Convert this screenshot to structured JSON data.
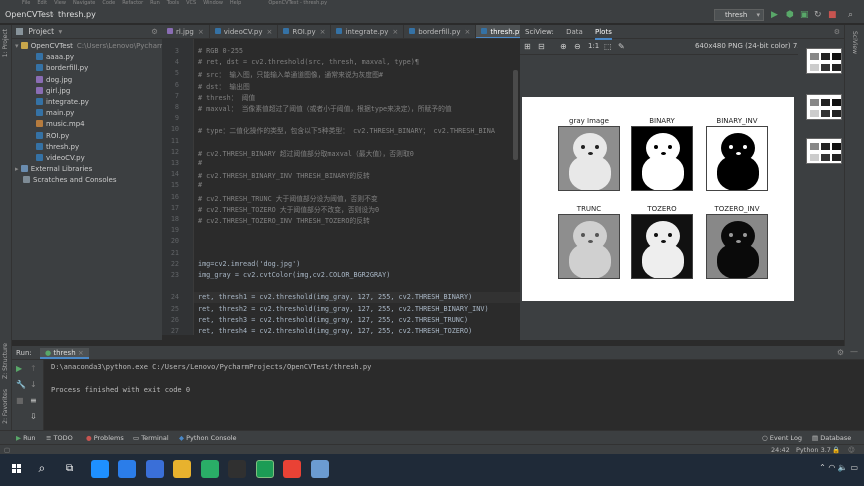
{
  "menu": [
    "File",
    "Edit",
    "View",
    "Navigate",
    "Code",
    "Refactor",
    "Run",
    "Tools",
    "VCS",
    "Window",
    "Help"
  ],
  "window_title": "OpenCVTest - thresh.py",
  "navbar": {
    "project": "OpenCVTest",
    "file": "thresh.py",
    "run_config": "thresh"
  },
  "project_panel": {
    "title": "Project",
    "root": {
      "name": "OpenCVTest",
      "path": "C:\\Users\\Lenovo\\PycharmProjects\\OpenCVTest"
    },
    "files": [
      "aaaa.py",
      "borderfill.py",
      "dog.jpg",
      "girl.jpg",
      "integrate.py",
      "main.py",
      "music.mp4",
      "ROI.py",
      "thresh.py",
      "videoCV.py"
    ],
    "external_libraries": "External Libraries",
    "scratches": "Scratches and Consoles"
  },
  "editor_tabs": [
    "rl.jpg",
    "videoCV.py",
    "ROI.py",
    "integrate.py",
    "borderfill.py",
    "thresh.py"
  ],
  "inspection": {
    "warnings": "4",
    "weak_warnings": "4"
  },
  "code_lines": [
    {
      "n": "3",
      "t": "# RGB 0-255"
    },
    {
      "n": "4",
      "t": "# ret, dst = cv2.threshold(src, thresh, maxval, type)¶"
    },
    {
      "n": "5",
      "t": "# src： 输入图，只能输入单通道图像，通常来说为灰度图#"
    },
    {
      "n": "6",
      "t": "# dst： 输出图"
    },
    {
      "n": "7",
      "t": "# thresh： 阈值"
    },
    {
      "n": "8",
      "t": "# maxval： 当像素值超过了阈值（或者小于阈值，根据type来决定），所赋予的值"
    },
    {
      "n": "9",
      "t": ""
    },
    {
      "n": "10",
      "t": "# type：二值化操作的类型，包含以下5种类型： cv2.THRESH_BINARY； cv2.THRESH_BINA"
    },
    {
      "n": "11",
      "t": ""
    },
    {
      "n": "12",
      "t": "# cv2.THRESH_BINARY 超过阈值部分取maxval（最大值），否则取0"
    },
    {
      "n": "13",
      "t": "#"
    },
    {
      "n": "14",
      "t": "# cv2.THRESH_BINARY_INV THRESH_BINARY的反转"
    },
    {
      "n": "15",
      "t": "#"
    },
    {
      "n": "16",
      "t": "# cv2.THRESH_TRUNC 大于阈值部分设为阈值，否则不变"
    },
    {
      "n": "17",
      "t": "# cv2.THRESH_TOZERO 大于阈值部分不改变，否则设为0"
    },
    {
      "n": "18",
      "t": "# cv2.THRESH_TOZERO_INV THRESH_TOZERO的反转"
    },
    {
      "n": "19",
      "t": ""
    },
    {
      "n": "20",
      "t": ""
    },
    {
      "n": "21",
      "t": ""
    },
    {
      "n": "22",
      "t": "img=cv2.imread('dog.jpg')"
    },
    {
      "n": "23",
      "t": "img_gray = cv2.cvtColor(img,cv2.COLOR_BGR2GRAY)"
    },
    {
      "n": "",
      "t": ""
    },
    {
      "n": "24",
      "t": "ret, thresh1 = cv2.threshold(img_gray, 127, 255, cv2.THRESH_BINARY)"
    },
    {
      "n": "25",
      "t": "ret, thresh2 = cv2.threshold(img_gray, 127, 255, cv2.THRESH_BINARY_INV)"
    },
    {
      "n": "26",
      "t": "ret, thresh3 = cv2.threshold(img_gray, 127, 255, cv2.THRESH_TRUNC)"
    },
    {
      "n": "27",
      "t": "ret, thresh4 = cv2.threshold(img_gray, 127, 255, cv2.THRESH_TOZERO)"
    }
  ],
  "sciview": {
    "title": "SciView:",
    "tabs": [
      "Data",
      "Plots"
    ],
    "image_info": "640x480 PNG (24-bit color) 73.01 kB",
    "toolbar_ratio": "1:1"
  },
  "plot_titles": [
    "gray Image",
    "BINARY",
    "BINARY_INV",
    "TRUNC",
    "TOZERO",
    "TOZERO_INV"
  ],
  "side_labels": {
    "project": "1: Project",
    "structure": "Z: Structure",
    "favorites": "2: Favorites",
    "sciview": "SciView"
  },
  "run_panel": {
    "label": "Run:",
    "config": "thresh"
  },
  "console_lines": [
    "D:\\anaconda3\\python.exe C:/Users/Lenovo/PycharmProjects/OpenCVTest/thresh.py",
    "",
    "Process finished with exit code 0"
  ],
  "bottom_tabs": [
    "Run",
    "TODO",
    "Problems",
    "Terminal",
    "Python Console",
    "Event Log",
    "Database"
  ],
  "statusbar": {
    "position": "24:42",
    "interpreter": "Python 3.7"
  },
  "taskbar_icons": [
    "windows-start",
    "search",
    "task-view",
    "edge",
    "mail",
    "store",
    "files",
    "wechat",
    "obs",
    "pycharm",
    "chrome",
    "notepad"
  ]
}
